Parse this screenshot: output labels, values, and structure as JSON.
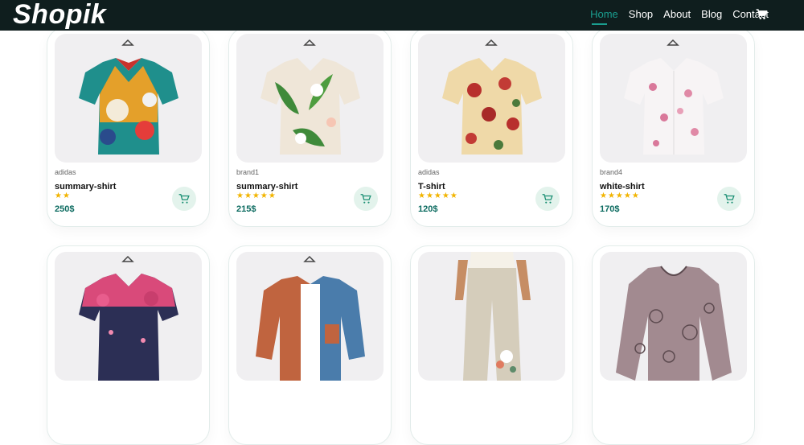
{
  "brand": {
    "logo": "Shopik"
  },
  "nav": {
    "items": [
      "Home",
      "Shop",
      "About",
      "Blog",
      "Contact"
    ],
    "active": "Home"
  },
  "colors": {
    "nav_bg": "#0f1e1e",
    "accent": "#1a9e8f",
    "price": "#0c6b60",
    "star": "#f2b400",
    "cart_bg": "#e3f3ec"
  },
  "products": [
    {
      "brand": "adidas",
      "name": "summary-shirt",
      "stars": "★★",
      "price": "250$"
    },
    {
      "brand": "brand1",
      "name": "summary-shirt",
      "stars": "★★★★★",
      "price": "215$"
    },
    {
      "brand": "adidas",
      "name": "T-shirt",
      "stars": "★★★★★",
      "price": "120$"
    },
    {
      "brand": "brand4",
      "name": "white-shirt",
      "stars": "★★★★★",
      "price": "170$"
    },
    {
      "brand": "",
      "name": "",
      "stars": "",
      "price": ""
    },
    {
      "brand": "",
      "name": "",
      "stars": "",
      "price": ""
    },
    {
      "brand": "",
      "name": "",
      "stars": "",
      "price": ""
    },
    {
      "brand": "",
      "name": "",
      "stars": "",
      "price": ""
    }
  ]
}
